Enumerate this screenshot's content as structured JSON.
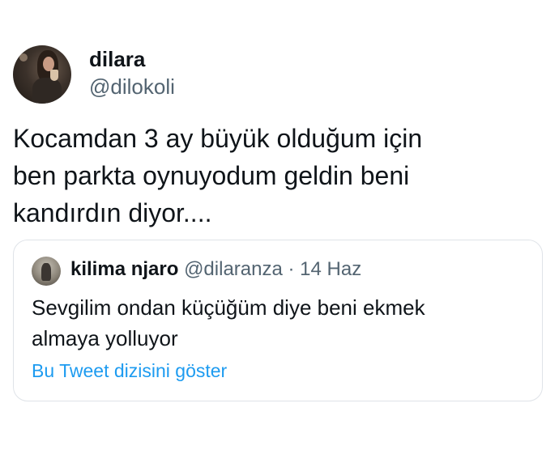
{
  "author": {
    "name": "dilara",
    "handle": "@dilokoli"
  },
  "tweet": {
    "lines": [
      "Kocamdan 3 ay büyük olduğum için",
      "ben parkta oynuyodum geldin beni",
      "kandırdın diyor...."
    ]
  },
  "quoted": {
    "name": "kilima njaro",
    "handle": "@dilaranza",
    "separator": "·",
    "date": "14 Haz",
    "lines": [
      "Sevgilim ondan küçüğüm diye beni ekmek",
      "almaya yolluyor"
    ],
    "show_thread": "Bu Tweet dizisini göster"
  },
  "colors": {
    "text": "#0f1419",
    "secondary": "#536471",
    "link": "#1d9bf0",
    "border": "#dfe3e8"
  },
  "icons": {
    "author_avatar": "avatar-photo",
    "quoted_avatar": "avatar-photo"
  }
}
